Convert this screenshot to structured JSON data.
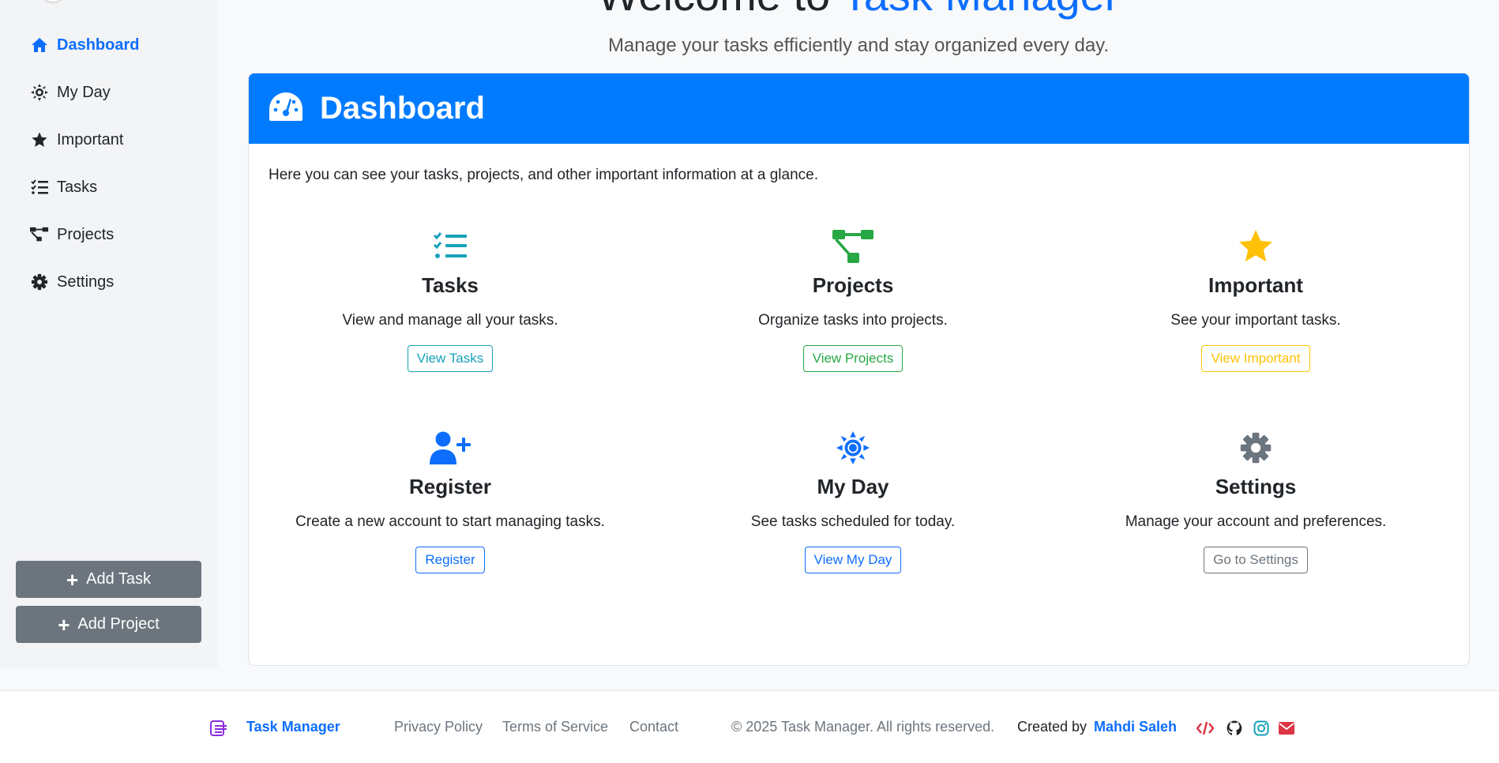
{
  "sidebar": {
    "items": [
      {
        "label": "Dashboard",
        "icon": "home-icon",
        "active": true
      },
      {
        "label": "My Day",
        "icon": "sun-icon"
      },
      {
        "label": "Important",
        "icon": "star-icon"
      },
      {
        "label": "Tasks",
        "icon": "list-check-icon"
      },
      {
        "label": "Projects",
        "icon": "project-diagram-icon"
      },
      {
        "label": "Settings",
        "icon": "gear-icon"
      }
    ],
    "add_task": "Add Task",
    "add_project": "Add Project"
  },
  "main": {
    "welcome_prefix": "Welcome to",
    "welcome_accent": "Task Manager",
    "subtitle": "Manage your tasks efficiently and stay organized every day."
  },
  "card": {
    "title": "Dashboard",
    "intro": "Here you can see your tasks, projects, and other important information at a glance.",
    "features": [
      {
        "name": "Tasks",
        "desc": "View and manage all your tasks.",
        "button": "View Tasks",
        "icon": "list-check-icon",
        "color": "#17a2b8"
      },
      {
        "name": "Projects",
        "desc": "Organize tasks into projects.",
        "button": "View Projects",
        "icon": "project-diagram-icon",
        "color": "#28a745"
      },
      {
        "name": "Important",
        "desc": "See your important tasks.",
        "button": "View Important",
        "icon": "star-icon",
        "color": "#ffc107"
      },
      {
        "name": "Register",
        "desc": "Create a new account to start managing tasks.",
        "button": "Register",
        "icon": "user-plus-icon",
        "color": "#0d6efd"
      },
      {
        "name": "My Day",
        "desc": "See tasks scheduled for today.",
        "button": "View My Day",
        "icon": "sun-icon",
        "color": "#0d6efd"
      },
      {
        "name": "Settings",
        "desc": "Manage your account and preferences.",
        "button": "Go to Settings",
        "icon": "gear-icon",
        "color": "#6c757d"
      }
    ]
  },
  "footer": {
    "brand": "Task Manager",
    "links": [
      "Privacy Policy",
      "Terms of Service",
      "Contact"
    ],
    "copyright": "© 2025 Task Manager. All rights reserved.",
    "created_by": "Created by",
    "author": "Mahdi Saleh"
  },
  "colors": {
    "accent": "#0d6efd",
    "header": "#007bff",
    "info": "#17a2b8",
    "success": "#28a745",
    "warning": "#ffc107",
    "secondary": "#6c757d"
  }
}
